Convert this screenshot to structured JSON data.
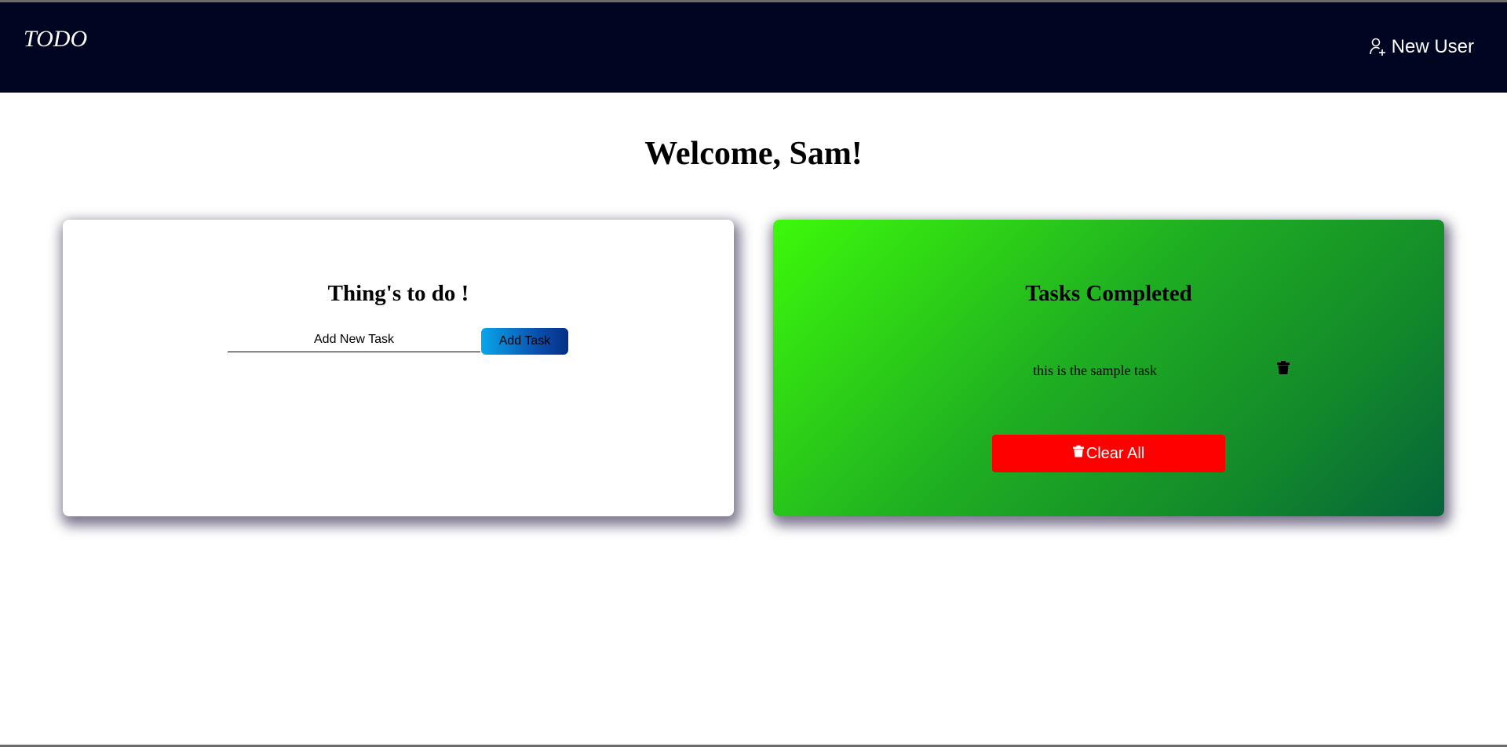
{
  "navbar": {
    "brand": "TODO",
    "new_user_label": "New User",
    "new_user_icon": "user-plus-icon",
    "background": "#000522"
  },
  "welcome": {
    "text": "Welcome, Sam!"
  },
  "todo_card": {
    "title": "Thing's to do !",
    "input_placeholder": "Add New Task",
    "input_value": "",
    "add_button_label": "Add Task"
  },
  "completed_card": {
    "title": "Tasks Completed",
    "tasks": [
      {
        "text": "this is the sample task",
        "delete_icon": "trash-icon"
      }
    ],
    "clear_all_label": "Clear All",
    "clear_all_icon": "trash-icon",
    "clear_all_color": "#ff0000",
    "gradient_colors": [
      "#3df90a",
      "#05643a"
    ]
  }
}
